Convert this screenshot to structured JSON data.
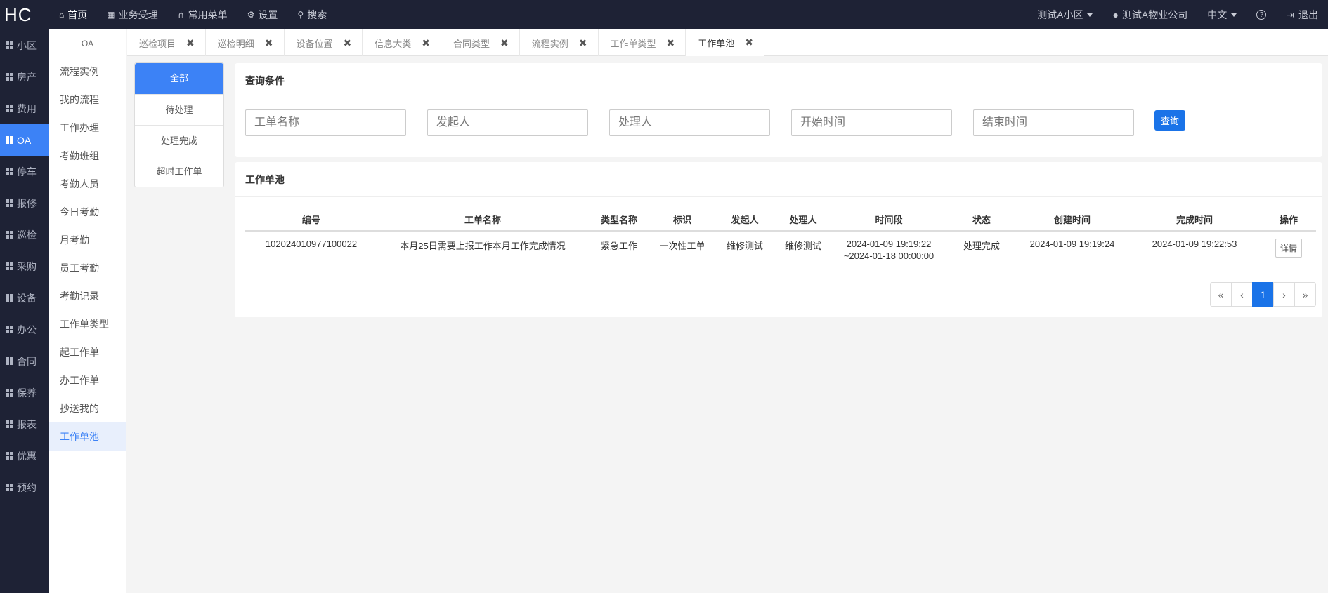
{
  "header": {
    "logo": "HC",
    "nav": [
      {
        "label": "首页",
        "icon": "home-icon"
      },
      {
        "label": "业务受理",
        "icon": "calculator-icon"
      },
      {
        "label": "常用菜单",
        "icon": "sitemap-icon"
      },
      {
        "label": "设置",
        "icon": "gear-icon"
      },
      {
        "label": "搜索",
        "icon": "search-icon"
      }
    ],
    "community": "测试A小区",
    "company": "测试A物业公司",
    "language": "中文",
    "help": "?",
    "logout": "退出"
  },
  "leftnav": [
    "小区",
    "房产",
    "费用",
    "OA",
    "停车",
    "报修",
    "巡检",
    "采购",
    "设备",
    "办公",
    "合同",
    "保养",
    "报表",
    "优惠",
    "预约"
  ],
  "subnav": {
    "title": "OA",
    "items": [
      "流程实例",
      "我的流程",
      "工作办理",
      "考勤班组",
      "考勤人员",
      "今日考勤",
      "月考勤",
      "员工考勤",
      "考勤记录",
      "工作单类型",
      "起工作单",
      "办工作单",
      "抄送我的",
      "工作单池"
    ]
  },
  "tabs": [
    "巡检项目",
    "巡检明细",
    "设备位置",
    "信息大类",
    "合同类型",
    "流程实例",
    "工作单类型",
    "工作单池"
  ],
  "status_filters": [
    "全部",
    "待处理",
    "处理完成",
    "超时工作单"
  ],
  "query": {
    "title": "查询条件",
    "placeholders": [
      "工单名称",
      "发起人",
      "处理人",
      "开始时间",
      "结束时间"
    ],
    "button": "查询"
  },
  "pool": {
    "title": "工作单池",
    "columns": [
      "编号",
      "工单名称",
      "类型名称",
      "标识",
      "发起人",
      "处理人",
      "时间段",
      "状态",
      "创建时间",
      "完成时间",
      "操作"
    ],
    "rows": [
      {
        "id": "102024010977100022",
        "name": "本月25日需要上报工作本月工作完成情况",
        "type": "紧急工作",
        "flag": "一次性工单",
        "creator": "维修测试",
        "handler": "维修测试",
        "period_start": "2024-01-09 19:19:22",
        "period_end": "~2024-01-18 00:00:00",
        "status": "处理完成",
        "created": "2024-01-09 19:19:24",
        "finished": "2024-01-09 19:22:53",
        "action": "详情"
      }
    ],
    "pager": [
      "«",
      "‹",
      "1",
      "›",
      "»"
    ]
  },
  "colors": {
    "accent": "#3c82f6",
    "dark": "#1e2235",
    "button": "#1a73e8"
  }
}
